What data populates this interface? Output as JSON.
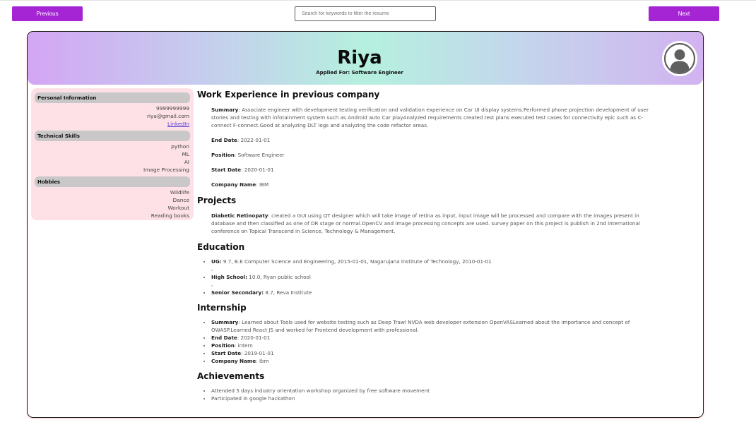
{
  "nav": {
    "previous_label": "Previous",
    "next_label": "Next",
    "search_placeholder": "Search for keywords to filter the resume",
    "accent_color": "#a524d4"
  },
  "header": {
    "name": "Riya",
    "applied_for": "Applied For: Software Engineer",
    "avatar_icon": "user-avatar-icon"
  },
  "sidebar": {
    "personal": {
      "title": "Personal Information",
      "phone": "9999999999",
      "email": "riya@gmail.com",
      "linkedin": "LinkedIn"
    },
    "skills": {
      "title": "Technical Skills",
      "items": [
        "python",
        "ML",
        "AI",
        "Image Processing"
      ]
    },
    "hobbies": {
      "title": "Hobbies",
      "items": [
        "Wildlife",
        "Dance",
        "Workout",
        "Reading books"
      ]
    }
  },
  "work": {
    "title": "Work Experience in previous company",
    "summary_label": "Summary",
    "summary": ": Associate engineer with development testing verification and validation experience on Car UI display systems.Performed phone projection development of user stories and testing with infotainment system such as Android auto Car playAnalyzed requirements created test plans executed test cases for connectivity epic such as C-connect F-connect.Good at analyzing DLT logs and analyzing the code refactor areas.",
    "end_date_label": "End Date",
    "end_date": ": 2022-01-01",
    "position_label": "Position",
    "position": ": Software Engineer",
    "start_date_label": "Start Date",
    "start_date": ": 2020-01-01",
    "company_label": "Company Name",
    "company": ": IBM"
  },
  "projects": {
    "title": "Projects",
    "name": "Diabetic Retinopaty",
    "description": ": created a GUI using QT designer which will take image of retina as input, input image will be processed and compare with the images present in database and then classified as one of DR stage or normal.OpenCV and image processing concepts are used. survey paper on this project is publish in 2nd international conference on Topical Transcend in Science, Technology & Management."
  },
  "education": {
    "title": "Education",
    "separator": ",",
    "items": [
      {
        "label": "UG:",
        "text": " 9.7, B.E Computer Science and Engineering, 2015-01-01, Nagarujana Institute of Technology, 2010-01-01"
      },
      {
        "label": "High School:",
        "text": " 10.0, Ryan public school"
      },
      {
        "label": "Senior Secondary:",
        "text": " 8.7, Reva Institute"
      }
    ]
  },
  "internship": {
    "title": "Internship",
    "summary_label": "Summary",
    "summary": ": Learned about Tools used for website testing such as Deep Trawl NVDA web developer extension OpenVASLearned about the importance and concept of OWASP.Learned React JS and worked for Frontend development with professional.",
    "end_date_label": "End Date",
    "end_date": ": 2020-01-01",
    "position_label": "Position",
    "position": ": intern",
    "start_date_label": "Start Date",
    "start_date": ": 2019-01-01",
    "company_label": "Company Name",
    "company": ": Ibm"
  },
  "achievements": {
    "title": "Achievements",
    "items": [
      "Attended 5 days industry orientation workshop organized by free software movement",
      "Participated in google hackathon"
    ]
  }
}
